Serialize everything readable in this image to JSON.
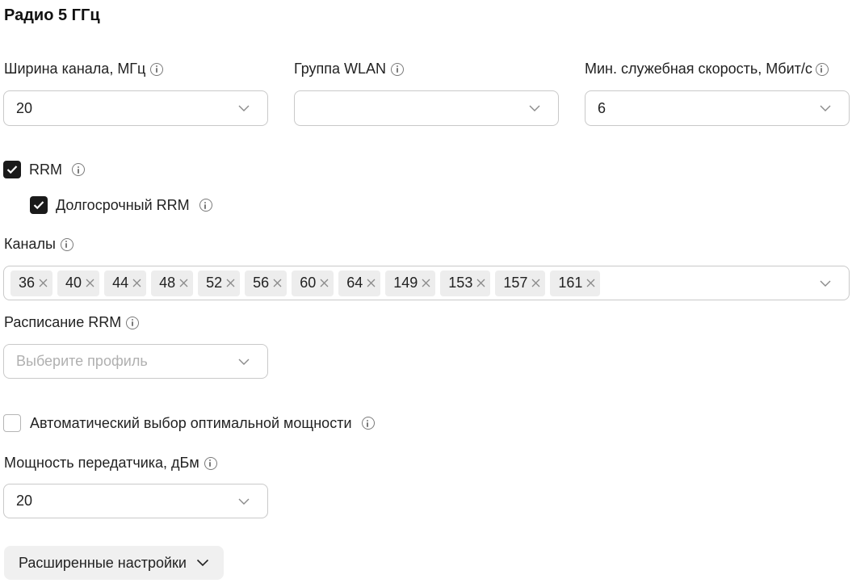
{
  "section_title": "Радио 5 ГГц",
  "channel_width": {
    "label": "Ширина канала, МГц",
    "value": "20"
  },
  "wlan_group": {
    "label": "Группа WLAN",
    "value": ""
  },
  "min_rate": {
    "label": "Мин. служебная скорость, Мбит/с",
    "value": "6"
  },
  "rrm": {
    "label": "RRM",
    "checked": true
  },
  "long_term_rrm": {
    "label": "Долгосрочный RRM",
    "checked": true
  },
  "channels": {
    "label": "Каналы",
    "tags": [
      "36",
      "40",
      "44",
      "48",
      "52",
      "56",
      "60",
      "64",
      "149",
      "153",
      "157",
      "161"
    ]
  },
  "rrm_schedule": {
    "label": "Расписание RRM",
    "placeholder": "Выберите профиль"
  },
  "auto_power": {
    "label": "Автоматический выбор оптимальной мощности",
    "checked": false
  },
  "tx_power": {
    "label": "Мощность передатчика, дБм",
    "value": "20"
  },
  "advanced_button": {
    "label": "Расширенные настройки"
  },
  "icons": {
    "info": "info-icon",
    "chevron": "chevron-down-icon",
    "check": "check-icon",
    "remove": "close-icon"
  }
}
